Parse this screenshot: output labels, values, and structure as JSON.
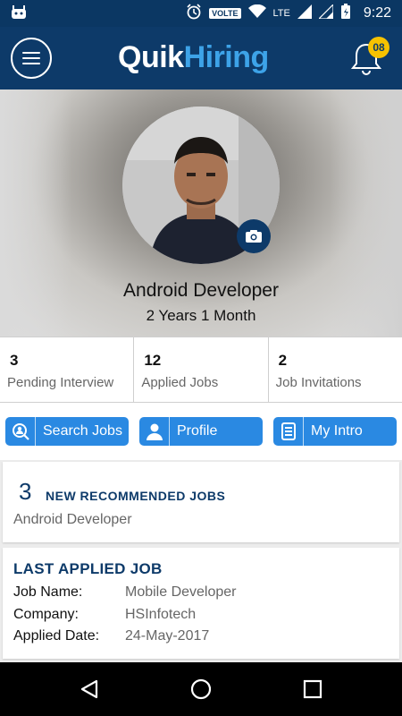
{
  "status_bar": {
    "network_label": "VOLTE",
    "lte_label": "LTE",
    "time": "9:22"
  },
  "app_bar": {
    "logo_part1": "Quik",
    "logo_part2": "Hiring",
    "notification_count": "08"
  },
  "profile": {
    "title": "Android Developer",
    "experience": "2 Years 1 Month"
  },
  "stats": [
    {
      "value": "3",
      "label": "Pending Interview"
    },
    {
      "value": "12",
      "label": "Applied Jobs"
    },
    {
      "value": "2",
      "label": "Job Invitations"
    }
  ],
  "actions": {
    "search_jobs": "Search Jobs",
    "profile": "Profile",
    "my_intro": "My Intro"
  },
  "recommended": {
    "count": "3",
    "title": "NEW RECOMMENDED JOBS",
    "subtitle": "Android Developer"
  },
  "last_applied": {
    "title": "LAST APPLIED JOB",
    "rows": [
      {
        "key": "Job Name:",
        "value": "Mobile Developer"
      },
      {
        "key": "Company:",
        "value": "HSInfotech"
      },
      {
        "key": "Applied Date:",
        "value": "24-May-2017"
      }
    ]
  },
  "colors": {
    "primary": "#0d3a69",
    "button": "#2a89e2",
    "badge": "#f6c200",
    "logo_accent": "#3da3e8"
  }
}
